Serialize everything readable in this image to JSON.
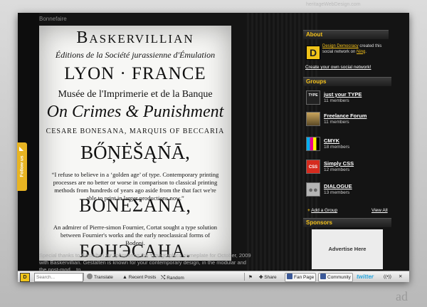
{
  "poster": {
    "caption": "Bonnefaire",
    "lines": [
      "Baskervillian",
      "Éditions de la Société jurassienne d'Émulation",
      "LYON · FRANCE",
      "Musée de l'Imprimerie et de la Banque",
      "On Crimes & Punishment",
      "CESARE BONESANA, MARQUIS OF BECCARIA",
      "BŐŅĖŠĄŃĀ,",
      "BONEΣANA,",
      "БОНЭСАНА."
    ],
    "paragraph1": "“I refuse to believe in a ‘golden age’ of type. Contemporary printing processes are no better or worse in comparison to classical printing methods from hundreds of years ago aside from the that fact we're able to print in larger productions now.”",
    "paragraph2": "An admirer of Pierre-simon Fournier, Cortat sought a type solution between Fournier's works and the early neoclassical forms of Bodoni.",
    "special": "Special thanks to Gestalten for sponsoring the Typographica nameplate for October, 2009 with Baskervillian. Gestalten is known for your contemporary design, in the modular and the post-mod... to"
  },
  "sidebar": {
    "site_url": "heritageWebDesign.com",
    "about_title": "About",
    "about_logo": "D",
    "about_text_name": "Design Democracy",
    "about_text_body": "created this social network on",
    "about_text_ning": "Ning",
    "create_link": "Create your own social network!",
    "groups_title": "Groups",
    "groups": [
      {
        "name": "just your TYPE",
        "members": "11 members",
        "thumb": "just your TYPE",
        "color": "#222222"
      },
      {
        "name": "Freelance Forum",
        "members": "11 members",
        "thumb": "",
        "color": "#7a6a3a"
      },
      {
        "name": "CMYK",
        "members": "18 members",
        "thumb": "",
        "color": "#00aeef"
      },
      {
        "name": "Simply CSS",
        "members": "12 members",
        "thumb": "CSS",
        "color": "#d52b1e"
      },
      {
        "name": "DIALOGUE",
        "members": "13 members",
        "thumb": "",
        "color": "#9a9a9a"
      }
    ],
    "add_group": "Add a Group",
    "view_all": "View All",
    "sponsors_title": "Sponsors",
    "ad_label": "Advertise Here"
  },
  "follow_tab": "Follow us",
  "toolbar": {
    "logo": "D",
    "search_placeholder": "Search...",
    "translate": "Translate",
    "recent_posts": "Recent Posts",
    "random": "Random",
    "share": "Share",
    "fan_page": "Fan Page",
    "community": "Community",
    "twitter": "twitter"
  },
  "watermark": "ad",
  "colors": {
    "accent": "#f5c21b",
    "facebook": "#3b5998",
    "twitter": "#2aa7de"
  }
}
